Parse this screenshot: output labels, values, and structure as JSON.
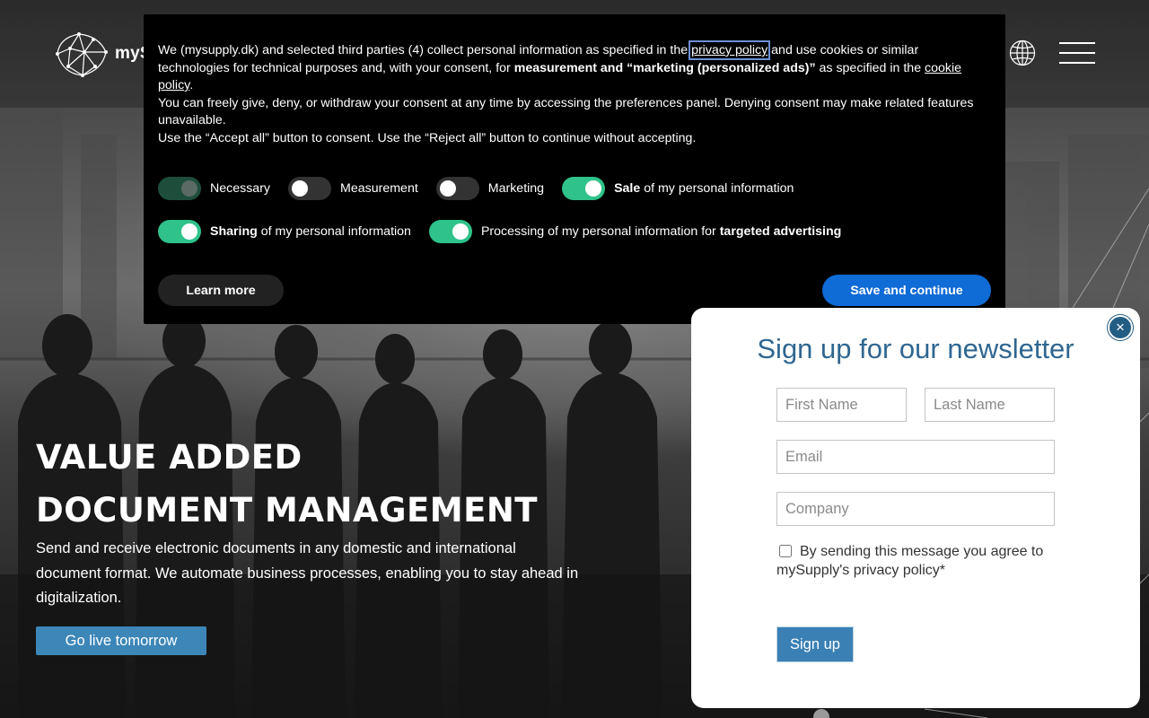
{
  "header": {
    "logo_text": "myS",
    "globe_icon": "globe-icon",
    "menu_icon": "hamburger-menu-icon"
  },
  "hero": {
    "title_line1": "VALUE ADDED",
    "title_line2": "DOCUMENT MANAGEMENT",
    "subtitle": "Send and receive electronic documents in any domestic and international document format. We automate business processes, enabling you to stay ahead in digitalization.",
    "cta_label": "Go live tomorrow"
  },
  "consent": {
    "p1_a": "We (mysupply.dk) and selected third parties (4) collect personal information as specified in the ",
    "privacy_link": "privacy policy",
    "p1_b": " and use cookies or similar technologies for technical purposes and, with your consent, for ",
    "p1_bold": "measurement and “marketing (personalized ads)”",
    "p1_c": " as specified in the ",
    "cookie_link": "cookie policy",
    "p1_d": ".",
    "p2": "You can freely give, deny, or withdraw your consent at any time by accessing the preferences panel. Denying consent may make related features unavailable.",
    "p3": "Use the “Accept all” button to consent. Use the “Reject all” button to continue without accepting.",
    "toggles": {
      "necessary": {
        "label": "Necessary",
        "state": "on-locked"
      },
      "measurement": {
        "label": "Measurement",
        "state": "off"
      },
      "marketing": {
        "label": "Marketing",
        "state": "off"
      },
      "sale": {
        "bold": "Sale",
        "rest": " of my personal information",
        "state": "on"
      },
      "sharing": {
        "bold": "Sharing",
        "rest": " of my personal information",
        "state": "on"
      },
      "processing": {
        "rest": "Processing of my personal information for ",
        "bold": "targeted advertising",
        "state": "on"
      }
    },
    "learn_more_label": "Learn more",
    "save_label": "Save and continue",
    "colors": {
      "toggle_on": "#2fc28a",
      "save_button": "#0f6bd6"
    }
  },
  "newsletter": {
    "close_label": "×",
    "title": "Sign up for our newsletter",
    "first_name_placeholder": "First Name",
    "last_name_placeholder": "Last Name",
    "email_placeholder": "Email",
    "company_placeholder": "Company",
    "consent_text": "By sending this message you agree to mySupply's privacy policy*",
    "submit_label": "Sign up",
    "colors": {
      "title": "#2f6690",
      "button": "#3a80b4"
    }
  }
}
